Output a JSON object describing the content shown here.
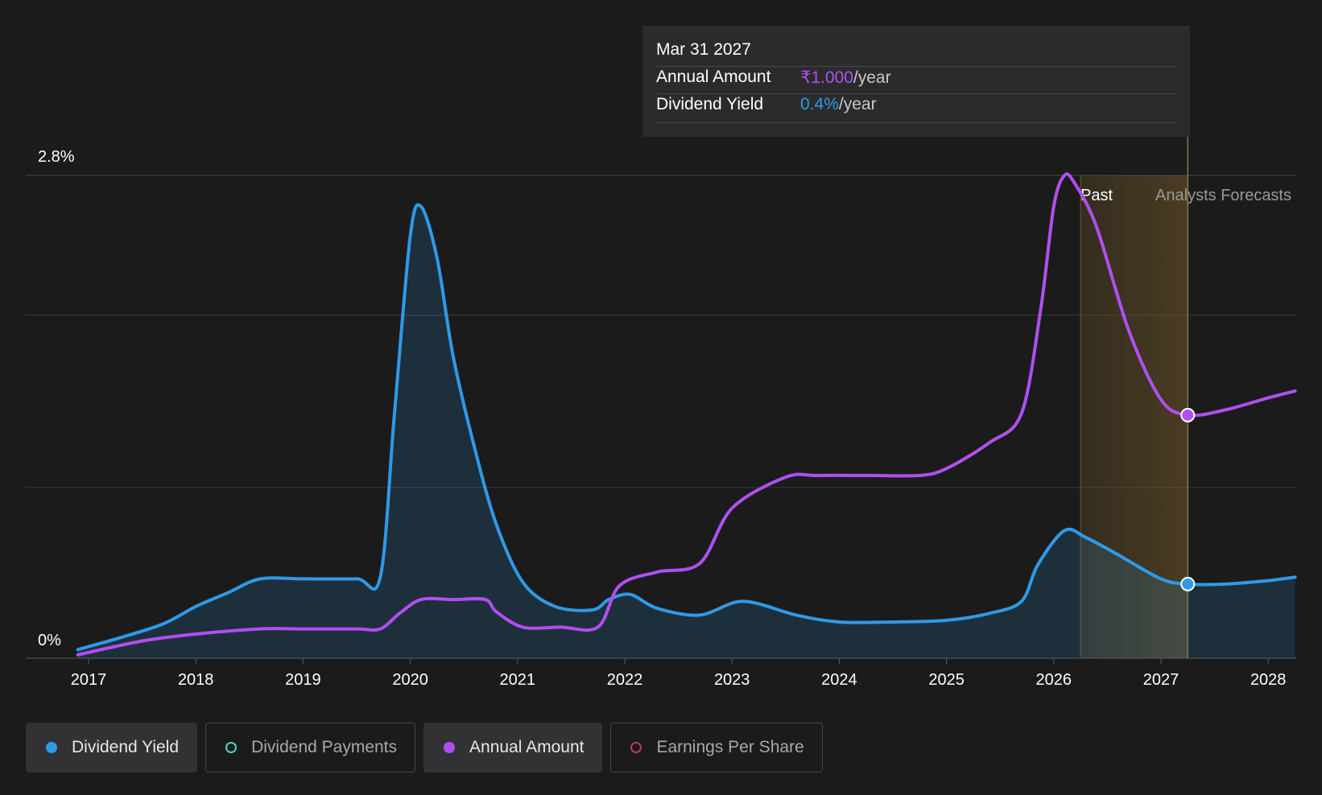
{
  "tooltip": {
    "date": "Mar 31 2027",
    "rows": [
      {
        "label": "Annual Amount",
        "value": "₹1.000",
        "unit": "/year",
        "color": "#b04ff0"
      },
      {
        "label": "Dividend Yield",
        "value": "0.4%",
        "unit": "/year",
        "color": "#2f9ae6"
      }
    ]
  },
  "legend": [
    {
      "label": "Dividend Yield",
      "active": true,
      "style": "filled",
      "color": "#2f9ae6"
    },
    {
      "label": "Dividend Payments",
      "active": false,
      "style": "ring",
      "color": "#4fd1c5"
    },
    {
      "label": "Annual Amount",
      "active": true,
      "style": "filled",
      "color": "#b04ff0"
    },
    {
      "label": "Earnings Per Share",
      "active": false,
      "style": "ring",
      "color": "#b03a6e"
    }
  ],
  "chart_data": {
    "type": "line",
    "x_axis": {
      "ticks": [
        "2017",
        "2018",
        "2019",
        "2020",
        "2021",
        "2022",
        "2023",
        "2024",
        "2025",
        "2026",
        "2027",
        "2028"
      ],
      "range": [
        2016.9,
        2028.25
      ]
    },
    "y_axis": {
      "labels": [
        "2.8%",
        "0%"
      ],
      "range": [
        0,
        2.8
      ],
      "unit": "%",
      "gridlines": [
        0,
        0.99,
        1.99,
        2.8
      ]
    },
    "past_label": "Past",
    "forecast_label": "Analysts Forecasts",
    "forecast_band": [
      2026.25,
      2027.25
    ],
    "cursor_x": 2027.25,
    "series": [
      {
        "name": "Dividend Yield",
        "color": "#2f9ae6",
        "filled": true,
        "axis": "yield",
        "x": [
          2016.9,
          2017.3,
          2017.7,
          2018.0,
          2018.3,
          2018.6,
          2019.0,
          2019.5,
          2019.72,
          2019.85,
          2020.0,
          2020.1,
          2020.25,
          2020.4,
          2020.6,
          2020.8,
          2021.05,
          2021.35,
          2021.7,
          2021.85,
          2022.05,
          2022.3,
          2022.7,
          2023.1,
          2023.6,
          2024.0,
          2024.5,
          2025.0,
          2025.4,
          2025.7,
          2025.85,
          2026.1,
          2026.3,
          2026.6,
          2027.0,
          2027.25,
          2027.6,
          2028.0,
          2028.25
        ],
        "y": [
          0.05,
          0.12,
          0.2,
          0.3,
          0.38,
          0.46,
          0.46,
          0.46,
          0.47,
          1.4,
          2.45,
          2.62,
          2.32,
          1.75,
          1.22,
          0.78,
          0.44,
          0.3,
          0.28,
          0.34,
          0.37,
          0.29,
          0.25,
          0.33,
          0.25,
          0.21,
          0.21,
          0.22,
          0.26,
          0.33,
          0.54,
          0.74,
          0.7,
          0.6,
          0.46,
          0.43,
          0.43,
          0.45,
          0.47
        ]
      },
      {
        "name": "Annual Amount",
        "color": "#b04ff0",
        "filled": false,
        "axis": "amount",
        "x": [
          2016.9,
          2017.5,
          2018.0,
          2018.6,
          2019.0,
          2019.5,
          2019.72,
          2019.9,
          2020.1,
          2020.4,
          2020.7,
          2020.8,
          2021.05,
          2021.4,
          2021.75,
          2021.95,
          2022.3,
          2022.7,
          2023.0,
          2023.5,
          2023.8,
          2024.3,
          2024.75,
          2025.0,
          2025.4,
          2025.7,
          2025.88,
          2026.0,
          2026.1,
          2026.2,
          2026.4,
          2026.7,
          2027.0,
          2027.25,
          2027.6,
          2028.0,
          2028.25
        ],
        "y": [
          0.02,
          0.1,
          0.14,
          0.17,
          0.17,
          0.17,
          0.17,
          0.26,
          0.34,
          0.34,
          0.34,
          0.27,
          0.18,
          0.18,
          0.18,
          0.42,
          0.5,
          0.55,
          0.87,
          1.05,
          1.06,
          1.06,
          1.06,
          1.1,
          1.25,
          1.42,
          2.03,
          2.62,
          2.8,
          2.75,
          2.5,
          1.9,
          1.5,
          1.41,
          1.44,
          1.51,
          1.55
        ]
      }
    ]
  }
}
